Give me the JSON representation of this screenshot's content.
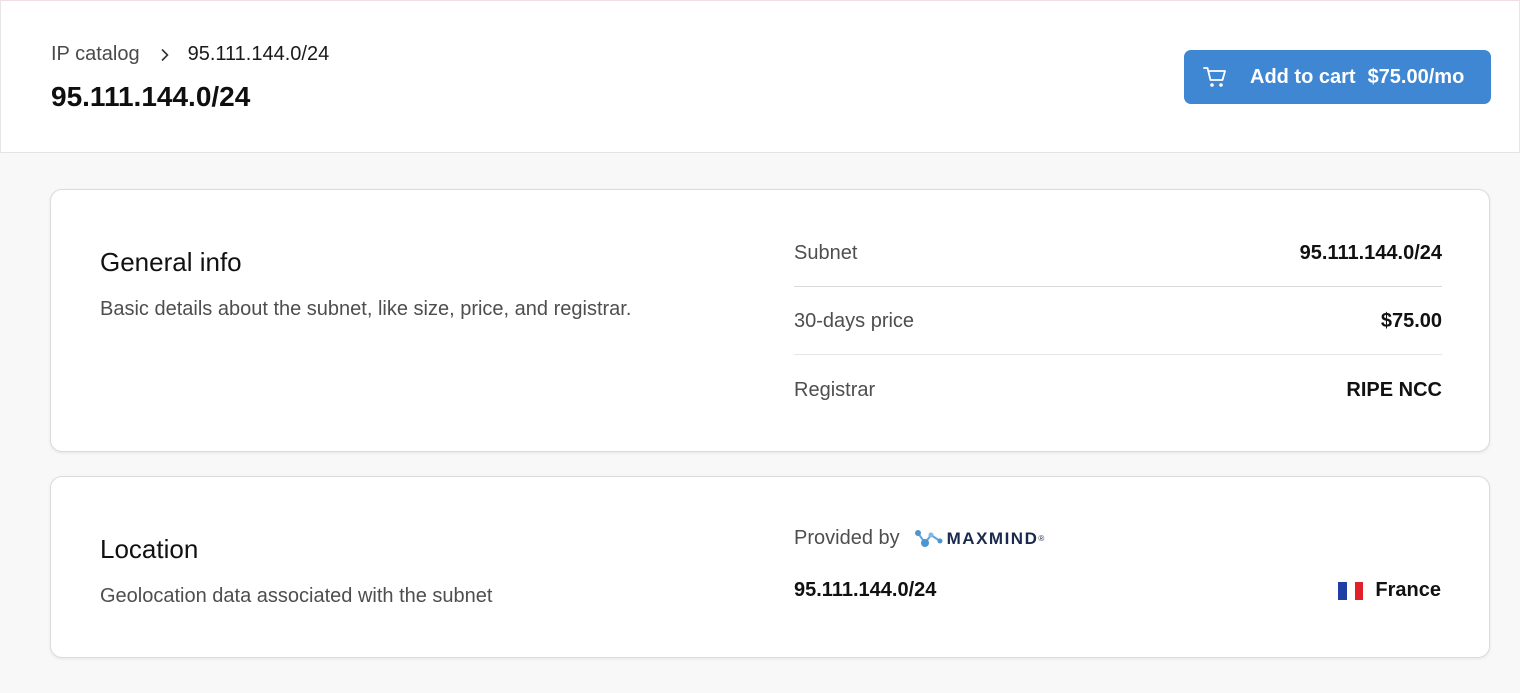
{
  "breadcrumb": {
    "parent": "IP catalog",
    "current": "95.111.144.0/24"
  },
  "page": {
    "title": "95.111.144.0/24"
  },
  "cart_button": {
    "label": "Add to cart",
    "price": "$75.00/mo",
    "icon": "cart-icon",
    "color": "#3f86d3"
  },
  "general": {
    "title": "General info",
    "description": "Basic details about the subnet, like size, price, and registrar.",
    "rows": [
      {
        "key": "Subnet",
        "value": "95.111.144.0/24"
      },
      {
        "key": "30-days price",
        "value": "$75.00"
      },
      {
        "key": "Registrar",
        "value": "RIPE NCC"
      }
    ]
  },
  "location": {
    "title": "Location",
    "description": "Geolocation data associated with the subnet",
    "provided_by": "Provided by",
    "provider": "MAXMIND",
    "provider_mark": "®",
    "subnet": "95.111.144.0/24",
    "country": "France",
    "flag_colors": [
      "#1f3fa5",
      "#ffffff",
      "#e0202a"
    ]
  }
}
